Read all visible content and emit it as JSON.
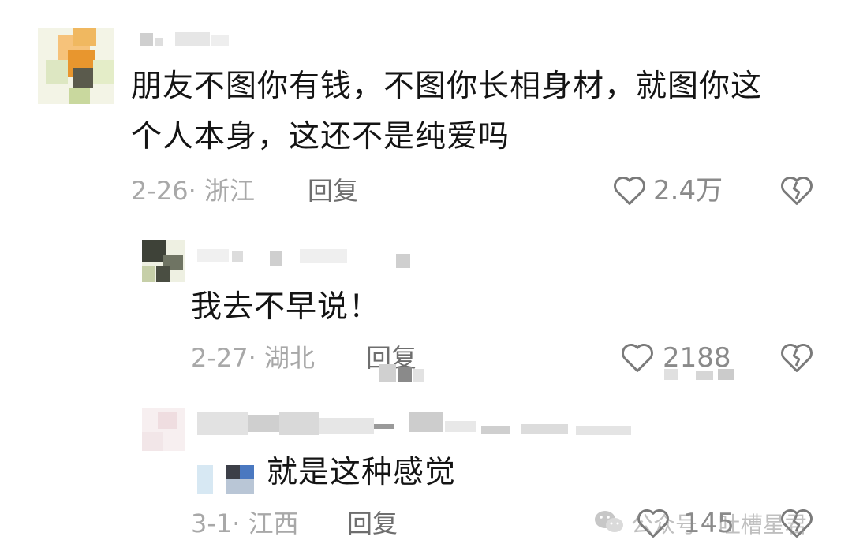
{
  "comments": [
    {
      "text_line1": "朋友不图你有钱，不图你长相身材，就图你这",
      "text_line2": "个人本身，这还不是纯爱吗",
      "meta": "2-26· 浙江",
      "reply": "回复",
      "likes": "2.4万"
    },
    {
      "text": "我去不早说！",
      "meta": "2-27· 湖北",
      "reply": "回复",
      "likes": "2188"
    },
    {
      "text": "就是这种感觉",
      "meta": "3-1· 江西",
      "reply": "回复",
      "likes": "145"
    }
  ],
  "watermark": {
    "text": "公众号 · 吐槽星君"
  },
  "colors": {
    "background": "#ffffff",
    "text": "#141414",
    "meta": "#a8a8a8",
    "icon": "#7a7a7a"
  }
}
